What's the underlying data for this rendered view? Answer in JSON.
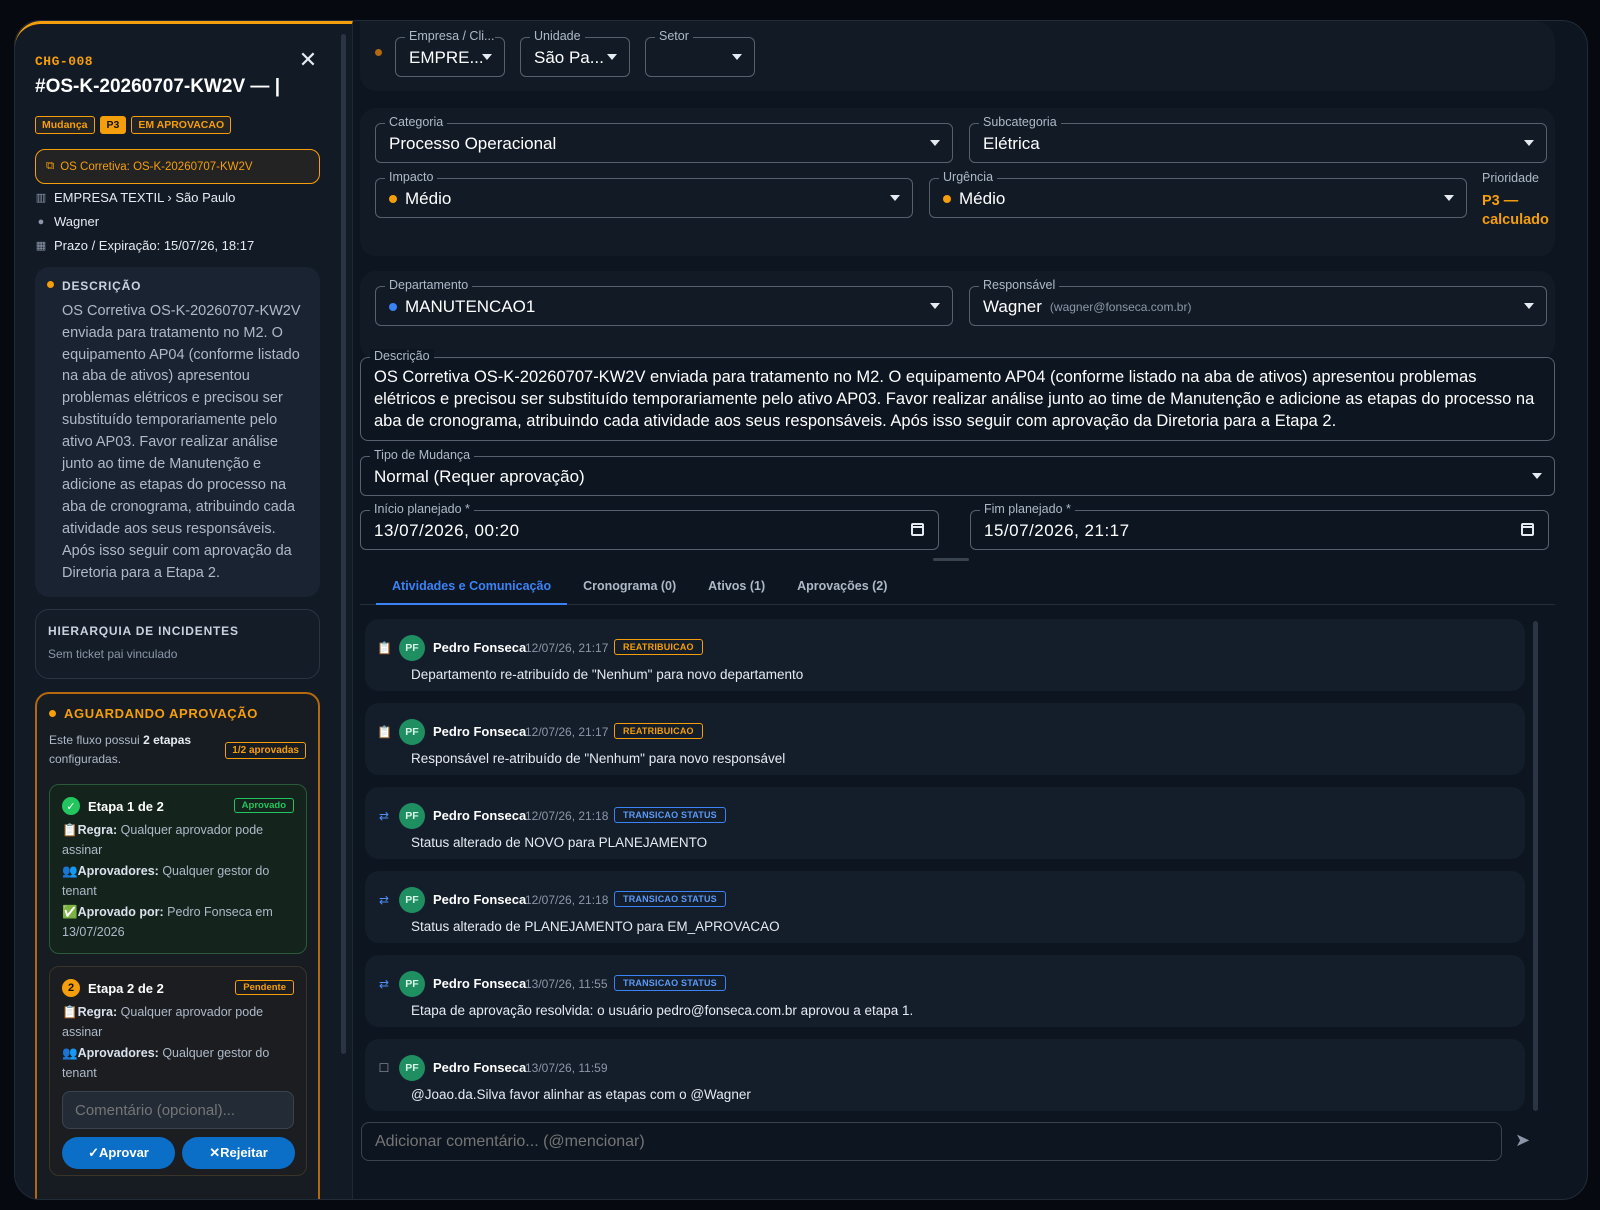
{
  "left": {
    "code": "CHG-008",
    "title": "#OS-K-20260707-KW2V — |",
    "badges": [
      "Mudança",
      "P3",
      "EM APROVACAO"
    ],
    "os_link": "OS Corretiva: OS-K-20260707-KW2V",
    "company_path": "EMPRESA TEXTIL › São Paulo",
    "user": "Wagner",
    "deadline": "Prazo / Expiração: 15/07/26, 18:17",
    "description_heading": "DESCRIÇÃO",
    "description": "OS Corretiva OS-K-20260707-KW2V enviada para tratamento no M2. O equipamento AP04 (conforme listado na aba de ativos) apresentou problemas elétricos e precisou ser substituído temporariamente pelo ativo AP03. Favor realizar análise junto ao time de Manutenção e adicione as etapas do processo na aba de cronograma, atribuindo cada atividade aos seus responsáveis. Após isso seguir com aprovação da Diretoria para a Etapa 2.",
    "hierarchy_heading": "HIERARQUIA DE INCIDENTES",
    "hierarchy_sub": "Sem ticket pai vinculado",
    "approval": {
      "heading": "AGUARDANDO APROVAÇÃO",
      "sub_pre": "Este fluxo possui ",
      "sub_bold": "2 etapas",
      "sub_post": " configuradas.",
      "count": "1/2 aprovadas",
      "stage1": {
        "title": "Etapa 1 de 2",
        "num": "✓",
        "badge": "Aprovado",
        "rule_label": "📋Regra:",
        "rule": " Qualquer aprovador pode assinar",
        "approvers_label": "👥Aprovadores:",
        "approvers": " Qualquer gestor do tenant",
        "approved_label": "✅Aprovado por:",
        "approved": " Pedro Fonseca em 13/07/2026"
      },
      "stage2": {
        "title": "Etapa 2 de 2",
        "num": "2",
        "badge": "Pendente",
        "rule_label": "📋Regra:",
        "rule": " Qualquer aprovador pode assinar",
        "approvers_label": "👥Aprovadores:",
        "approvers": " Qualquer gestor do tenant",
        "comment_placeholder": "Comentário (opcional)...",
        "approve": "✓Aprovar",
        "reject": "✕Rejeitar"
      }
    }
  },
  "form": {
    "empresa": {
      "label": "Empresa / Cli...",
      "value": "EMPRE..."
    },
    "unidade": {
      "label": "Unidade",
      "value": "São Pa..."
    },
    "setor": {
      "label": "Setor",
      "value": ""
    },
    "categoria": {
      "label": "Categoria",
      "value": "Processo Operacional"
    },
    "subcategoria": {
      "label": "Subcategoria",
      "value": "Elétrica"
    },
    "impacto": {
      "label": "Impacto",
      "value": "Médio"
    },
    "urgencia": {
      "label": "Urgência",
      "value": "Médio"
    },
    "prioridade": {
      "label": "Prioridade",
      "value": "P3 — calculado"
    },
    "departamento": {
      "label": "Departamento",
      "value": "MANUTENCAO1"
    },
    "responsavel": {
      "label": "Responsável",
      "value": "Wagner",
      "email": "(wagner@fonseca.com.br)"
    },
    "descricao": {
      "label": "Descrição",
      "value": "OS Corretiva OS-K-20260707-KW2V enviada para tratamento no M2. O equipamento AP04 (conforme listado na aba de ativos) apresentou problemas elétricos e precisou ser substituído temporariamente pelo ativo AP03. Favor realizar análise junto ao time de Manutenção e adicione as etapas do processo na aba de cronograma, atribuindo cada atividade aos seus responsáveis. Após isso seguir com aprovação da Diretoria para a Etapa 2."
    },
    "tipo_mudanca": {
      "label": "Tipo de Mudança",
      "value": "Normal (Requer aprovação)"
    },
    "inicio": {
      "label": "Início planejado *",
      "value": "13/07/2026, 00:20"
    },
    "fim": {
      "label": "Fim planejado *",
      "value": "15/07/2026, 21:17"
    }
  },
  "tabs": [
    "Atividades e Comunicação",
    "Cronograma (0)",
    "Ativos (1)",
    "Aprovações (2)"
  ],
  "activities": [
    {
      "icon": "clipboard-icon",
      "glyph": "📋",
      "avatar": "PF",
      "who": "Pedro Fonseca",
      "when": "12/07/26, 21:17",
      "tag": "REATRIBUICAO",
      "text": "Departamento re-atribuído de \"Nenhum\" para novo departamento"
    },
    {
      "icon": "clipboard-icon",
      "glyph": "📋",
      "avatar": "PF",
      "who": "Pedro Fonseca",
      "when": "12/07/26, 21:17",
      "tag": "REATRIBUICAO",
      "text": "Responsável re-atribuído de \"Nenhum\" para novo responsável"
    },
    {
      "icon": "swap-icon",
      "glyph": "⇄",
      "avatar": "PF",
      "who": "Pedro Fonseca",
      "when": "12/07/26, 21:18",
      "tag": "TRANSICAO STATUS",
      "text": "Status alterado de NOVO para PLANEJAMENTO"
    },
    {
      "icon": "swap-icon",
      "glyph": "⇄",
      "avatar": "PF",
      "who": "Pedro Fonseca",
      "when": "12/07/26, 21:18",
      "tag": "TRANSICAO STATUS",
      "text": "Status alterado de PLANEJAMENTO para EM_APROVACAO"
    },
    {
      "icon": "swap-icon",
      "glyph": "⇄",
      "avatar": "PF",
      "who": "Pedro Fonseca",
      "when": "13/07/26, 11:55",
      "tag": "TRANSICAO STATUS",
      "text": "Etapa de aprovação resolvida: o usuário pedro@fonseca.com.br aprovou a etapa 1."
    },
    {
      "icon": "message-icon",
      "glyph": "☐",
      "avatar": "PF",
      "who": "Pedro Fonseca",
      "when": "13/07/26, 11:59",
      "tag": "",
      "text": "@Joao.da.Silva favor alinhar as etapas com o @Wagner"
    }
  ],
  "comment_placeholder": "Adicionar comentário... (@mencionar)",
  "colors": {
    "accent": "#f59e0b",
    "link": "#3b82f6",
    "success": "#22c55e",
    "background": "#0d1520"
  }
}
